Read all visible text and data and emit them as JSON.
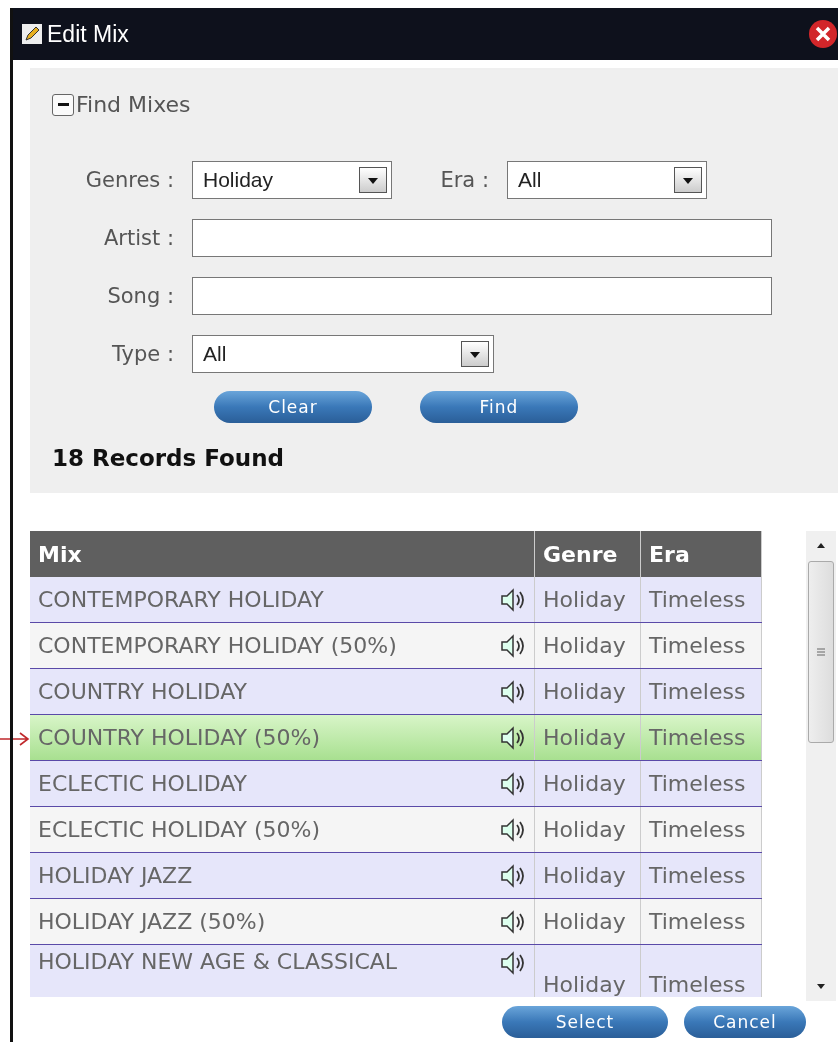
{
  "window": {
    "title": "Edit Mix"
  },
  "find_panel": {
    "title": "Find Mixes",
    "expanded": true,
    "genres": {
      "label": "Genres :",
      "value": "Holiday"
    },
    "era": {
      "label": "Era :",
      "value": "All"
    },
    "artist": {
      "label": "Artist :"
    },
    "song": {
      "label": "Song :"
    },
    "type": {
      "label": "Type :",
      "value": "All"
    },
    "buttons": [
      "Clear",
      "Find"
    ],
    "result_count": "18 Records Found"
  },
  "table": {
    "columns": [
      "Mix",
      "Genre",
      "Era"
    ],
    "rows": [
      {
        "mix": "CONTEMPORARY HOLIDAY",
        "genre": "Holiday",
        "era": "Timeless",
        "selected": false
      },
      {
        "mix": "CONTEMPORARY HOLIDAY (50%)",
        "genre": "Holiday",
        "era": "Timeless",
        "selected": false
      },
      {
        "mix": "COUNTRY HOLIDAY",
        "genre": "Holiday",
        "era": "Timeless",
        "selected": false
      },
      {
        "mix": "COUNTRY HOLIDAY (50%)",
        "genre": "Holiday",
        "era": "Timeless",
        "selected": true
      },
      {
        "mix": "ECLECTIC HOLIDAY",
        "genre": "Holiday",
        "era": "Timeless",
        "selected": false
      },
      {
        "mix": "ECLECTIC HOLIDAY (50%)",
        "genre": "Holiday",
        "era": "Timeless",
        "selected": false
      },
      {
        "mix": "HOLIDAY JAZZ",
        "genre": "Holiday",
        "era": "Timeless",
        "selected": false
      },
      {
        "mix": "HOLIDAY JAZZ (50%)",
        "genre": "Holiday",
        "era": "Timeless",
        "selected": false
      },
      {
        "mix": "HOLIDAY NEW AGE & CLASSICAL",
        "genre": "Holiday",
        "era": "Timeless",
        "selected": false
      }
    ]
  },
  "buttons": [
    "Select",
    "Cancel"
  ]
}
